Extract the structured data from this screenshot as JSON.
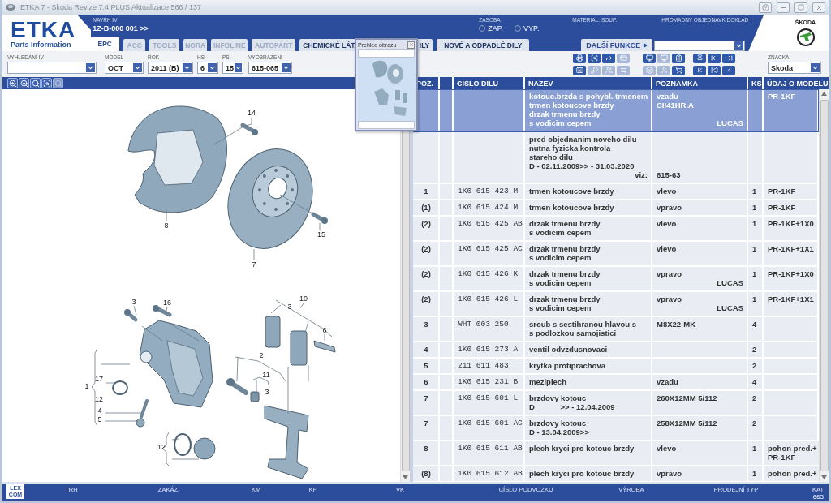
{
  "window": {
    "title": "ETKA 7 - Skoda Revize 7.4 PLUS Aktualizace 566 / 137"
  },
  "logo": {
    "name": "ETKA",
    "subtitle": "Parts Information"
  },
  "header": {
    "proposal": {
      "label": "NAVRH IV",
      "value": "1Z-B-000 001 >>"
    },
    "stock": {
      "label": "ZASOBA",
      "options": [
        {
          "label": "ZAP.",
          "selected": false
        },
        {
          "label": "VYP.",
          "selected": false
        }
      ]
    },
    "links": [
      "MATERIAL. SOUP.",
      "HROMADNY OBJEDNAVK.DOKLAD"
    ],
    "brand_logo": "ŠKODA"
  },
  "tabs": [
    {
      "label": "EPC",
      "selected": true,
      "disabled": false
    },
    {
      "label": "ACC",
      "selected": false,
      "disabled": true
    },
    {
      "label": "TOOLS",
      "selected": false,
      "disabled": true
    },
    {
      "label": "NORA",
      "selected": false,
      "disabled": true
    },
    {
      "label": "INFOLINE",
      "selected": false,
      "disabled": true
    },
    {
      "label": "AUTOPART",
      "selected": false,
      "disabled": true
    },
    {
      "label": "CHEMICKÉ LÁT",
      "label_tail": "ILY",
      "selected": false,
      "disabled": false
    },
    {
      "label": "NOVÉ A ODPADLÉ DILY",
      "selected": false,
      "disabled": false
    }
  ],
  "more_functions": {
    "label": "DALŠÍ FUNKCE"
  },
  "filters": [
    {
      "label": "VYHLEDÁNÍ IV"
    },
    {
      "label": "MODEL",
      "value": "OCT"
    },
    {
      "label": "ROK",
      "value": "2011 (B)"
    },
    {
      "label": "HS",
      "value": "6"
    },
    {
      "label": "PS",
      "value": "15"
    },
    {
      "label": "VYOBRAZENÍ",
      "value": "615-065"
    }
  ],
  "toolbar": [
    {
      "kind": "printer",
      "disabled": false
    },
    {
      "kind": "scan",
      "disabled": false
    },
    {
      "kind": "forward",
      "disabled": false
    },
    {
      "kind": "card",
      "disabled": true
    },
    {
      "kind": "monitor",
      "disabled": false
    },
    {
      "kind": "monitor",
      "disabled": true
    },
    {
      "kind": "list",
      "disabled": false
    },
    {
      "kind": "pin",
      "disabled": false
    },
    {
      "kind": "to-start",
      "disabled": false
    },
    {
      "kind": "to-end",
      "disabled": false
    },
    {
      "kind": "keyboard",
      "disabled": false
    },
    {
      "kind": "key",
      "disabled": true
    },
    {
      "kind": "users",
      "disabled": true
    },
    {
      "kind": "swap",
      "disabled": true
    },
    {
      "kind": "layers",
      "disabled": true
    },
    {
      "kind": "user",
      "disabled": true
    },
    {
      "kind": "cart",
      "disabled": false
    },
    {
      "kind": "first",
      "disabled": false
    },
    {
      "kind": "back",
      "disabled": false
    },
    {
      "kind": "prev",
      "disabled": false
    }
  ],
  "brand_select": {
    "label": "ZNACKA",
    "value": "Skoda"
  },
  "zoom_tools": [
    {
      "kind": "zoom-in",
      "disabled": false
    },
    {
      "kind": "zoom-out",
      "disabled": false
    },
    {
      "kind": "search",
      "disabled": false
    },
    {
      "kind": "scan",
      "disabled": false
    },
    {
      "kind": "search",
      "disabled": true
    }
  ],
  "diagram": {
    "callouts": [
      "14",
      "8",
      "15",
      "7",
      "3",
      "16",
      "10",
      "3",
      "6",
      "2",
      "11",
      "3",
      "17",
      "1",
      "12",
      "4",
      "5",
      "12"
    ]
  },
  "preview_window": {
    "title": "Prehled obrazu"
  },
  "table": {
    "columns": [
      "POZ.",
      "CÍSLO DÍLU",
      "NÁZEV",
      "POZNÁMKA",
      "KS",
      "ÚDAJ O MODELU"
    ],
    "rows": [
      {
        "selected": true,
        "name": "kotouc.brzda s pohybl. trmenem\ntrmen kotoucove brzdy\ndrzak trmenu brzdy\ns vodicim cepem",
        "note": "vzadu\nCII41HR.A",
        "note_brand": "LUCAS",
        "model": "PR-1KF"
      },
      {
        "selected": false,
        "name": "pred objednanim noveho dilu\nnutna fyzicka kontrola\nstareho dilu\nD - 02.11.2009>> - 31.03.2020",
        "ref_label": "viz:",
        "ref": "615-63"
      },
      {
        "selected": false,
        "poz": "1",
        "part_no": "1K0 615 423 M",
        "name": "trmen kotoucove brzdy",
        "note": "vlevo",
        "ks": "1",
        "model": "PR-1KF"
      },
      {
        "selected": false,
        "poz": "(1)",
        "part_no": "1K0 615 424 M",
        "name": "trmen kotoucove brzdy",
        "note": "vpravo",
        "ks": "1",
        "model": "PR-1KF"
      },
      {
        "selected": false,
        "poz": "(2)",
        "part_no": "1K0 615 425 AB",
        "name": "drzak trmenu brzdy\ns vodicim cepem",
        "note": "vlevo",
        "ks": "1",
        "model": "PR-1KF+1X0"
      },
      {
        "selected": false,
        "poz": "(2)",
        "part_no": "1K0 615 425 AC",
        "name": "drzak trmenu brzdy\ns vodicim cepem",
        "note": "vlevo",
        "ks": "1",
        "model": "PR-1KF+1X1"
      },
      {
        "selected": false,
        "poz": "(2)",
        "part_no": "1K0 615 426 K",
        "name": "drzak trmenu brzdy\ns vodicim cepem",
        "note": "vpravo",
        "note_brand": "LUCAS",
        "ks": "1",
        "model": "PR-1KF+1X0"
      },
      {
        "selected": false,
        "poz": "(2)",
        "part_no": "1K0 615 426 L",
        "name": "drzak trmenu brzdy\ns vodicim cepem",
        "note": "vpravo",
        "note_brand": "LUCAS",
        "ks": "1",
        "model": "PR-1KF+1X1"
      },
      {
        "selected": false,
        "poz": "3",
        "part_no": "WHT 003 250",
        "name": "sroub s sestihranou hlavou s\ns podlozkou samojistici",
        "note": "M8X22-MK",
        "ks": "4"
      },
      {
        "selected": false,
        "poz": "4",
        "part_no": "1K0 615 273 A",
        "name": "ventil odvzdusnovaci",
        "ks": "2"
      },
      {
        "selected": false,
        "poz": "5",
        "part_no": "211 611 483",
        "name": "krytka protiprachova",
        "ks": "2"
      },
      {
        "selected": false,
        "poz": "6",
        "part_no": "1K0 615 231 B",
        "name": "meziplech",
        "note": "vzadu",
        "ks": "4"
      },
      {
        "selected": false,
        "poz": "7",
        "part_no": "1K0 615 601 L",
        "name": "brzdovy kotouc\nD            >> - 12.04.2009",
        "note": "260X12MM 5/112",
        "ks": "2"
      },
      {
        "selected": false,
        "poz": "7",
        "part_no": "1K0 615 601 AC",
        "name": "brzdovy kotouc\nD - 13.04.2009>>",
        "note": "258X12MM 5/112",
        "ks": "2"
      },
      {
        "selected": false,
        "poz": "8",
        "part_no": "1K0 615 611 AB",
        "name": "plech kryci pro kotouc brzdy",
        "note": "vlevo",
        "ks": "1",
        "model": "pohon pred.+\nPR-1KF"
      },
      {
        "selected": false,
        "poz": "(8)",
        "part_no": "1K0 615 612 AB",
        "name": "plech kryci pro kotouc brzdy",
        "note": "vpravo",
        "ks": "1",
        "model": "pohon pred.+"
      }
    ]
  },
  "status_bar": {
    "logo": "LEX\nCOM",
    "fields": [
      {
        "label": "TRH"
      },
      {
        "label": "ZAKÁZ."
      },
      {
        "label": "KM"
      },
      {
        "label": "KP"
      },
      {
        "label": "VK"
      },
      {
        "label": "CÍSLO PODVOZKU"
      },
      {
        "label": "VÝROBA"
      },
      {
        "label": "PRODEJNÍ TYP"
      },
      {
        "label": "KAT",
        "value": "663"
      }
    ]
  }
}
